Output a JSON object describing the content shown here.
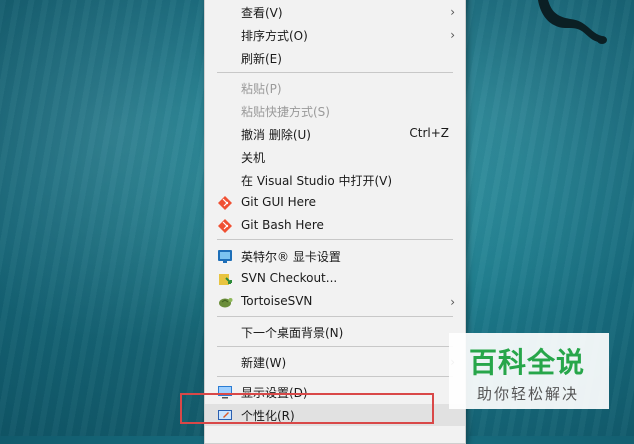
{
  "context_menu": {
    "items": [
      {
        "label": "查看(V)",
        "submenu": true
      },
      {
        "label": "排序方式(O)",
        "submenu": true
      },
      {
        "label": "刷新(E)"
      },
      {
        "label": "粘贴(P)",
        "disabled": true
      },
      {
        "label": "粘贴快捷方式(S)",
        "disabled": true
      },
      {
        "label": "撤消 删除(U)",
        "shortcut": "Ctrl+Z"
      },
      {
        "label": "关机"
      },
      {
        "label": "在 Visual Studio 中打开(V)"
      },
      {
        "label": "Git GUI Here",
        "icon": "git-icon"
      },
      {
        "label": "Git Bash Here",
        "icon": "git-icon"
      },
      {
        "label": "英特尔® 显卡设置",
        "icon": "intel-graphics-icon"
      },
      {
        "label": "SVN Checkout...",
        "icon": "svn-checkout-icon"
      },
      {
        "label": "TortoiseSVN",
        "icon": "tortoise-icon",
        "submenu": true
      },
      {
        "label": "下一个桌面背景(N)"
      },
      {
        "label": "新建(W)",
        "submenu": true
      },
      {
        "label": "显示设置(D)",
        "icon": "display-icon"
      },
      {
        "label": "个性化(R)",
        "icon": "personalize-icon",
        "hovered": true
      }
    ],
    "submenu_arrow": "›"
  },
  "watermark": {
    "title": "百科全说",
    "subtitle": "助你轻松解决"
  },
  "colors": {
    "highlight_box": "#d94848",
    "watermark_green": "#27a64a"
  }
}
